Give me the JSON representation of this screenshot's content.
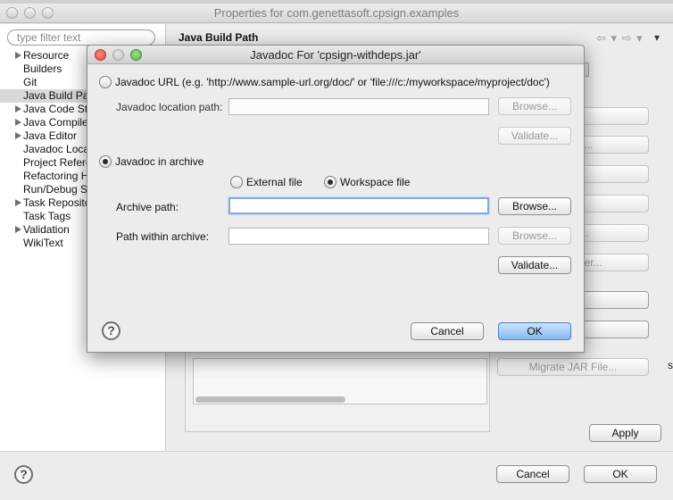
{
  "window": {
    "title": "Properties for com.genettasoft.cpsign.examples",
    "filter_placeholder": "type filter text",
    "tree": [
      {
        "label": "Resource",
        "expandable": true
      },
      {
        "label": "Builders",
        "expandable": false
      },
      {
        "label": "Git",
        "expandable": false
      },
      {
        "label": "Java Build Pat",
        "expandable": false,
        "selected": true
      },
      {
        "label": "Java Code Sty",
        "expandable": true
      },
      {
        "label": "Java Compiler",
        "expandable": true
      },
      {
        "label": "Java Editor",
        "expandable": true
      },
      {
        "label": "Javadoc Locat",
        "expandable": false
      },
      {
        "label": "Project Refere",
        "expandable": false
      },
      {
        "label": "Refactoring H",
        "expandable": false
      },
      {
        "label": "Run/Debug S",
        "expandable": false
      },
      {
        "label": "Task Reposito",
        "expandable": true
      },
      {
        "label": "Task Tags",
        "expandable": false
      },
      {
        "label": "Validation",
        "expandable": true
      },
      {
        "label": "WikiText",
        "expandable": false
      }
    ],
    "section_title": "Java Build Path",
    "nav_arrows": "⇦ ▾ ⇨ ▾",
    "view_menu": "▾",
    "background_buttons": [
      "s...",
      "l JARs...",
      "ble...",
      "ary...",
      "older...",
      "ass Folder...",
      "t...",
      "ve",
      "Migrate JAR File..."
    ],
    "side_mark": "s",
    "apply_label": "Apply",
    "cancel_label": "Cancel",
    "ok_label": "OK",
    "help_glyph": "?"
  },
  "dialog": {
    "title": "Javadoc For 'cpsign-withdeps.jar'",
    "url_option_label": "Javadoc URL (e.g. 'http://www.sample-url.org/doc/' or 'file:///c:/myworkspace/myproject/doc')",
    "location_path_label": "Javadoc location path:",
    "location_path_value": "",
    "browse_label": "Browse...",
    "validate_label": "Validate...",
    "archive_option_label": "Javadoc in archive",
    "external_file_label": "External file",
    "workspace_file_label": "Workspace file",
    "archive_path_label": "Archive path:",
    "archive_path_value": "",
    "path_within_label": "Path within archive:",
    "path_within_value": "",
    "cancel_label": "Cancel",
    "ok_label": "OK",
    "help_glyph": "?",
    "selected_option": "archive",
    "selected_source": "workspace"
  }
}
